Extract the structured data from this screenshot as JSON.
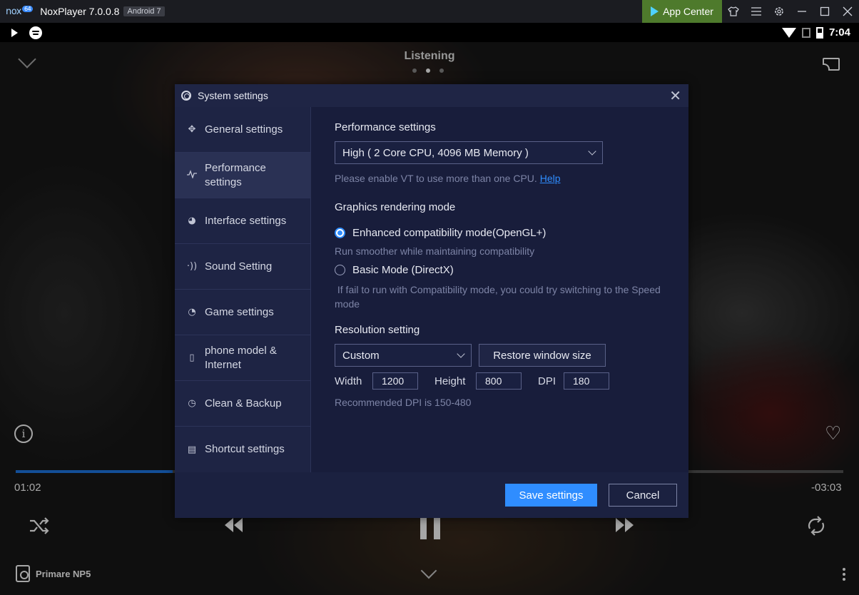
{
  "titlebar": {
    "logo": "nox",
    "logo_badge": "64",
    "title": "NoxPlayer 7.0.0.8",
    "android_badge": "Android 7",
    "app_center": "App Center",
    "icons": [
      "tshirt-icon",
      "menu-icon",
      "gear-icon",
      "minimize-icon",
      "maximize-icon",
      "close-icon"
    ]
  },
  "statusbar": {
    "time": "7:04"
  },
  "player": {
    "header": "Listening",
    "current_page": 2,
    "page_count": 3,
    "elapsed": "01:02",
    "remaining": "-03:03",
    "progress": 0.19,
    "device": "Primare NP5",
    "accent": "#1e78e8"
  },
  "dialog": {
    "title": "System settings",
    "sidebar": [
      {
        "label": "General settings",
        "icon": "puzzle-icon",
        "active": false
      },
      {
        "label": "Performance settings",
        "icon": "pulse-icon",
        "active": true
      },
      {
        "label": "Interface settings",
        "icon": "palette-icon",
        "active": false
      },
      {
        "label": "Sound Setting",
        "icon": "sound-icon",
        "active": false
      },
      {
        "label": "Game settings",
        "icon": "gauge-icon",
        "active": false
      },
      {
        "label": "phone model & Internet",
        "icon": "phone-icon",
        "active": false
      },
      {
        "label": "Clean & Backup",
        "icon": "history-icon",
        "active": false
      },
      {
        "label": "Shortcut settings",
        "icon": "keyboard-icon",
        "active": false
      }
    ],
    "performance": {
      "title": "Performance settings",
      "selected": "High ( 2 Core CPU, 4096 MB Memory )",
      "hint": "Please enable VT to use more than one CPU.",
      "help": "Help"
    },
    "graphics": {
      "title": "Graphics rendering mode",
      "option1": "Enhanced compatibility mode(OpenGL+)",
      "option1_hint": "Run smoother while maintaining compatibility",
      "option2": "Basic Mode (DirectX)",
      "option2_hint": " If fail to run with Compatibility mode, you could try switching to the Speed mode",
      "selected": "Enhanced compatibility mode(OpenGL+)"
    },
    "resolution": {
      "title": "Resolution setting",
      "selected": "Custom",
      "restore": "Restore window size",
      "width_label": "Width",
      "width": "1200",
      "height_label": "Height",
      "height": "800",
      "dpi_label": "DPI",
      "dpi": "180",
      "hint": "Recommended DPI is 150-480"
    },
    "save": "Save settings",
    "cancel": "Cancel",
    "accent": "#2f8dff"
  }
}
